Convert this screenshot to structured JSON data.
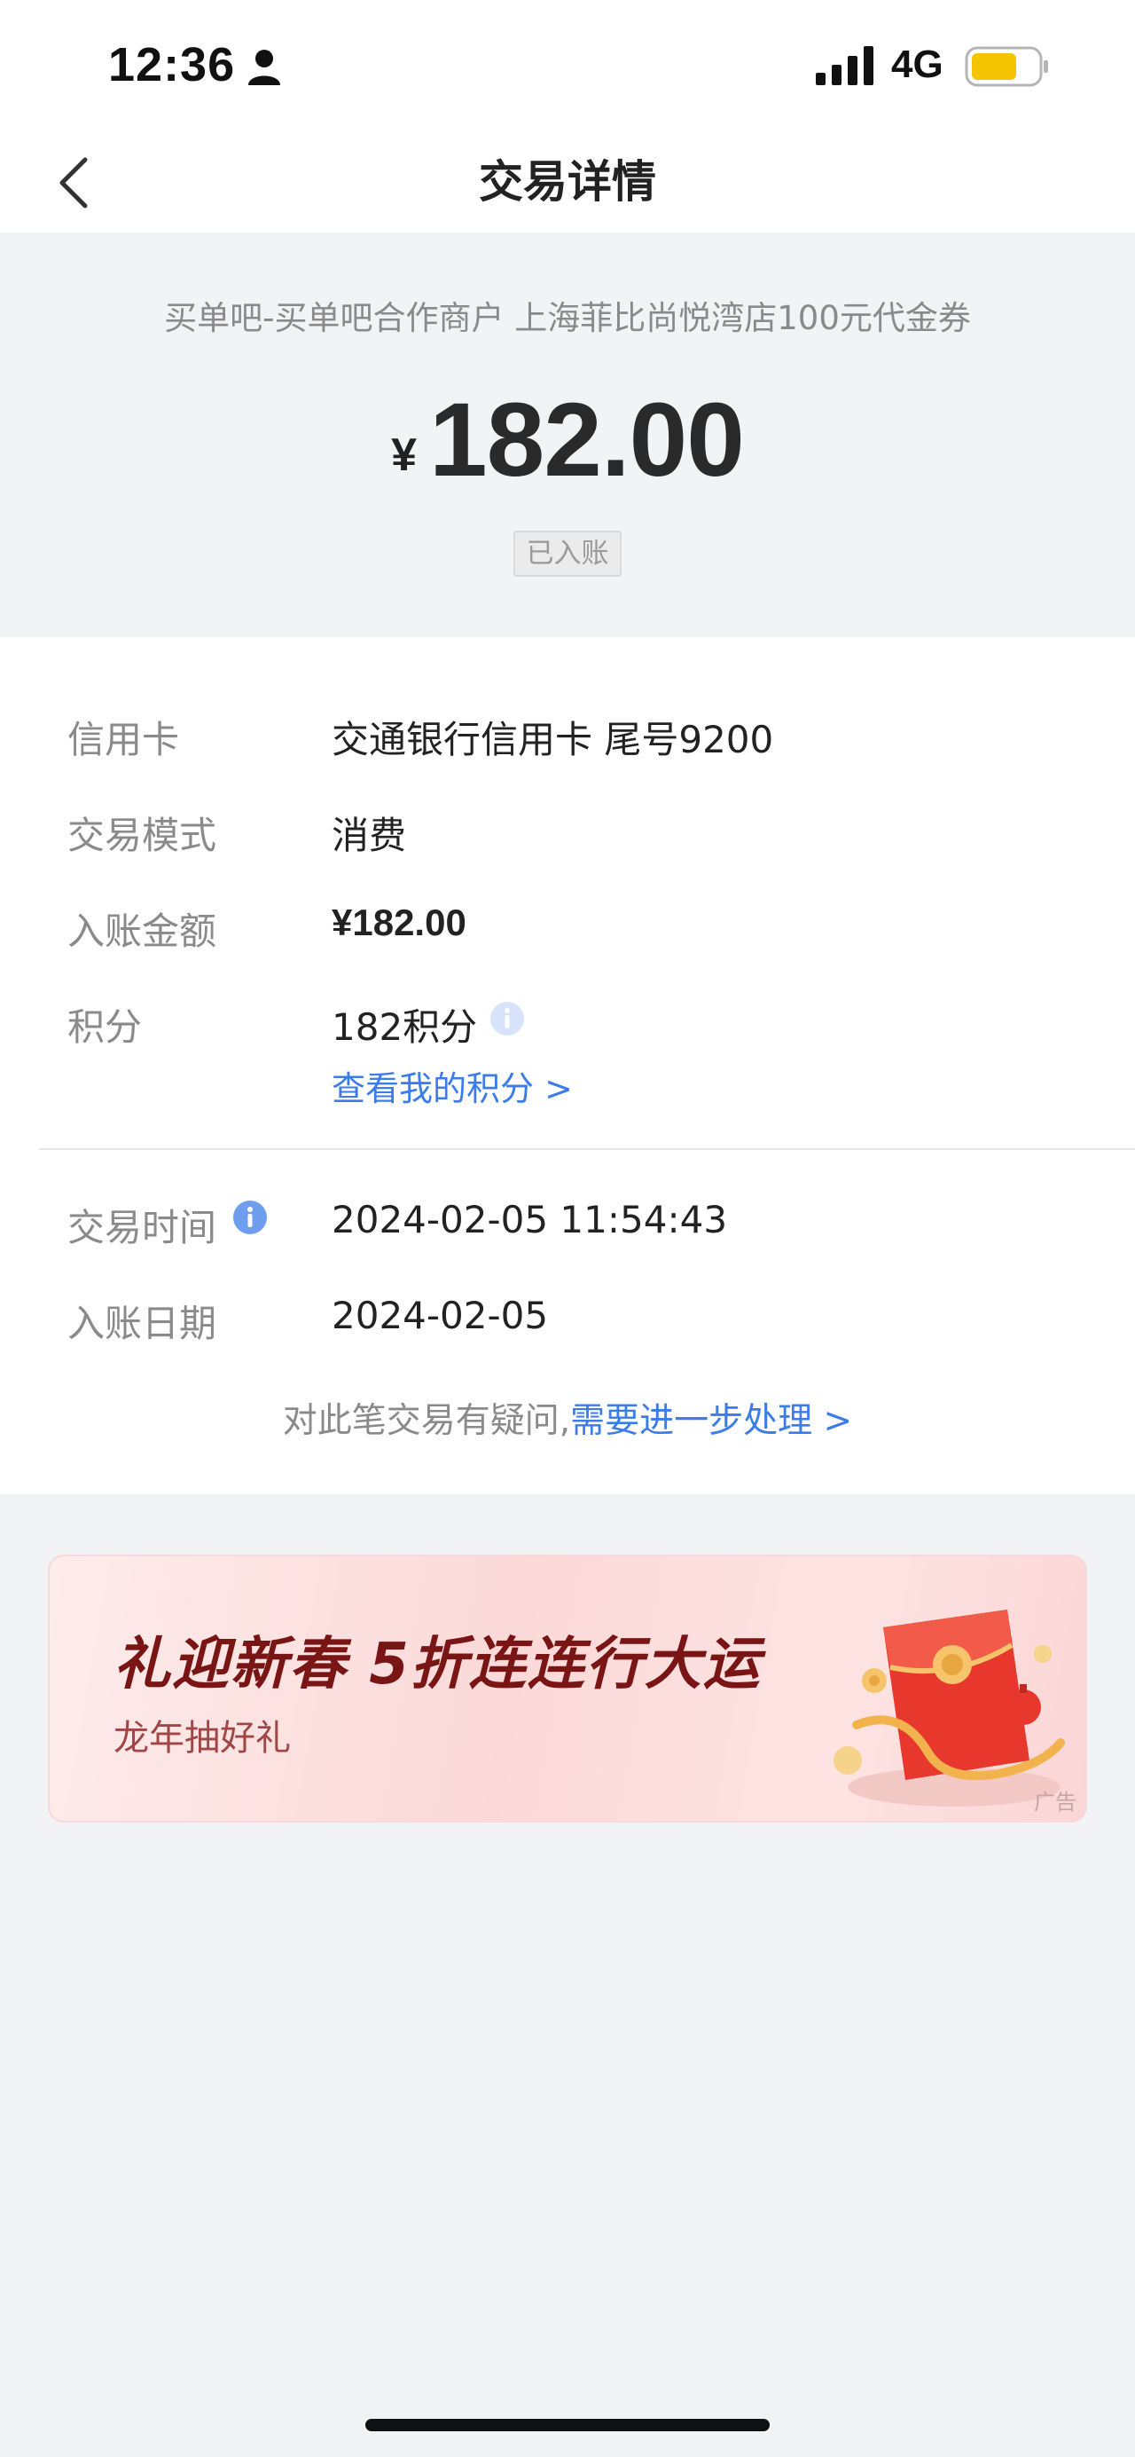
{
  "status_bar": {
    "time": "12:36",
    "network": "4G",
    "icons": [
      "person-icon",
      "signal-icon",
      "battery-icon"
    ]
  },
  "nav": {
    "title": "交易详情",
    "back_icon": "chevron-left-icon"
  },
  "summary": {
    "merchant": "买单吧-买单吧合作商户 上海菲比尚悦湾店100元代金券",
    "currency": "¥",
    "amount": "182.00",
    "status": "已入账"
  },
  "details": {
    "rows": [
      {
        "label": "信用卡",
        "value": "交通银行信用卡 尾号9200"
      },
      {
        "label": "交易模式",
        "value": "消费"
      },
      {
        "label": "入账金额",
        "value": "¥182.00"
      },
      {
        "label": "积分",
        "value": "182积分"
      },
      {
        "label": "交易时间",
        "value": "2024-02-05 11:54:43"
      },
      {
        "label": "入账日期",
        "value": "2024-02-05"
      }
    ],
    "points_link": "查看我的积分 >",
    "help_prefix": "对此笔交易有疑问,",
    "help_link": "需要进一步处理 >"
  },
  "ad": {
    "title": "礼迎新春 5折连连行大运",
    "subtitle": "龙年抽好礼",
    "tag": "广告"
  },
  "colors": {
    "accent": "#3b7ce8",
    "background": "#f2f3f5",
    "ad_title": "#7a1515",
    "battery": "#f5c400"
  }
}
